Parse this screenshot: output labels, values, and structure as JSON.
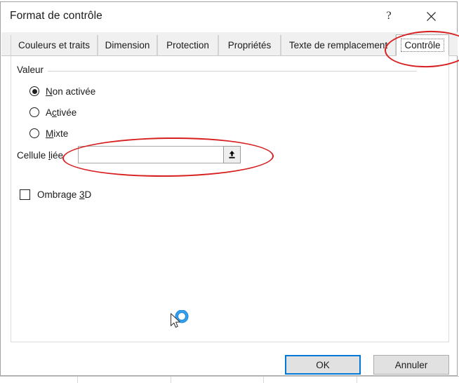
{
  "window": {
    "title": "Format de contrôle",
    "help_label": "?",
    "close_label": "✕"
  },
  "tabs": [
    {
      "label": "Couleurs et traits",
      "selected": false
    },
    {
      "label": "Dimension",
      "selected": false
    },
    {
      "label": "Protection",
      "selected": false
    },
    {
      "label": "Propriétés",
      "selected": false
    },
    {
      "label": "Texte de remplacement",
      "selected": false
    },
    {
      "label": "Contrôle",
      "selected": true
    }
  ],
  "control_tab": {
    "group_legend": "Valeur",
    "radios": [
      {
        "label_before": "",
        "accel": "N",
        "label_after": "on activée",
        "checked": true
      },
      {
        "label_before": "A",
        "accel": "c",
        "label_after": "tivée",
        "checked": false
      },
      {
        "label_before": "",
        "accel": "M",
        "label_after": "ixte",
        "checked": false
      }
    ],
    "linked_cell": {
      "label_before": "Cellule ",
      "accel": "l",
      "label_after": "iée",
      "value": "",
      "placeholder": "",
      "picker_icon": "collapse-dialog-icon"
    },
    "shadow": {
      "label_before": "Ombrage ",
      "accel": "3",
      "label_after": "D",
      "checked": false
    }
  },
  "footer": {
    "ok_label": "OK",
    "cancel_label": "Annuler"
  },
  "annotations": {
    "tab_highlight": "red-ellipse-around-controle-tab",
    "linked_cell_highlight": "red-ellipse-around-cellule-liee-field"
  },
  "cursor": {
    "type": "busy-working-cursor",
    "icon": "arrow-with-spinner-icon"
  },
  "colors": {
    "accent": "#0078d7",
    "annotation": "#d81f20",
    "dialog_bg": "#ffffff",
    "tabstrip_bg": "#f0f0f0",
    "button_bg": "#e1e1e1"
  }
}
